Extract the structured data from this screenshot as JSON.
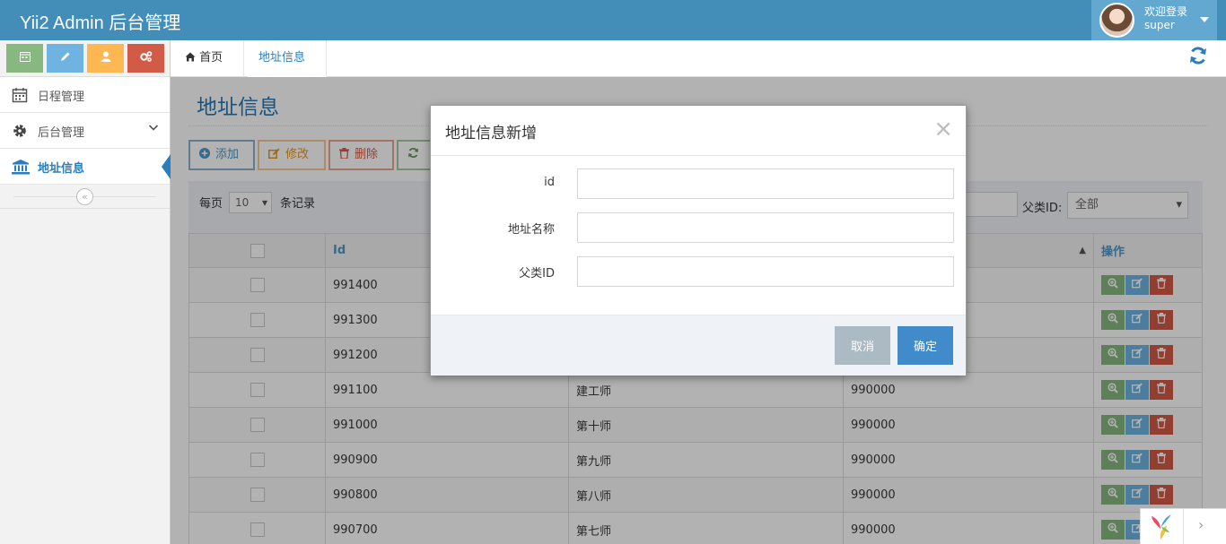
{
  "navbar": {
    "brand": "Yii2 Admin 后台管理",
    "welcome": "欢迎登录",
    "username": "super"
  },
  "sidebar": {
    "items": [
      {
        "label": "日程管理",
        "icon": "calendar-icon"
      },
      {
        "label": "后台管理",
        "icon": "gear-icon"
      },
      {
        "label": "地址信息",
        "icon": "bank-icon"
      }
    ],
    "collapse_glyph": "«"
  },
  "tabs": [
    {
      "label": "首页",
      "close": "✖"
    },
    {
      "label": "地址信息",
      "close": "✖"
    }
  ],
  "main": {
    "title": "地址信息",
    "toolbar": {
      "add": "添加",
      "edit": "修改",
      "delete": "删除"
    },
    "filter": {
      "per_page": "每页",
      "per_page_value": "10",
      "records": "条记录",
      "parent_label": "父类ID:",
      "parent_value": "全部"
    },
    "table": {
      "headers": {
        "id": "Id",
        "op": "操作"
      },
      "rows": [
        {
          "id": "991400",
          "name": "",
          "pid": ""
        },
        {
          "id": "991300",
          "name": "",
          "pid": ""
        },
        {
          "id": "991200",
          "name": "",
          "pid": ""
        },
        {
          "id": "991100",
          "name": "建工师",
          "pid": "990000"
        },
        {
          "id": "991000",
          "name": "第十师",
          "pid": "990000"
        },
        {
          "id": "990900",
          "name": "第九师",
          "pid": "990000"
        },
        {
          "id": "990800",
          "name": "第八师",
          "pid": "990000"
        },
        {
          "id": "990700",
          "name": "第七师",
          "pid": "990000"
        }
      ]
    }
  },
  "modal": {
    "title": "地址信息新增",
    "close": "×",
    "fields": [
      {
        "label": "id",
        "value": ""
      },
      {
        "label": "地址名称",
        "value": ""
      },
      {
        "label": "父类ID",
        "value": ""
      }
    ],
    "cancel": "取消",
    "ok": "确定"
  },
  "colors": {
    "navbar": "#438eb9",
    "accent": "#2b7dbc",
    "danger": "#d15b47",
    "success": "#87b87f",
    "warning": "#ffb752"
  }
}
